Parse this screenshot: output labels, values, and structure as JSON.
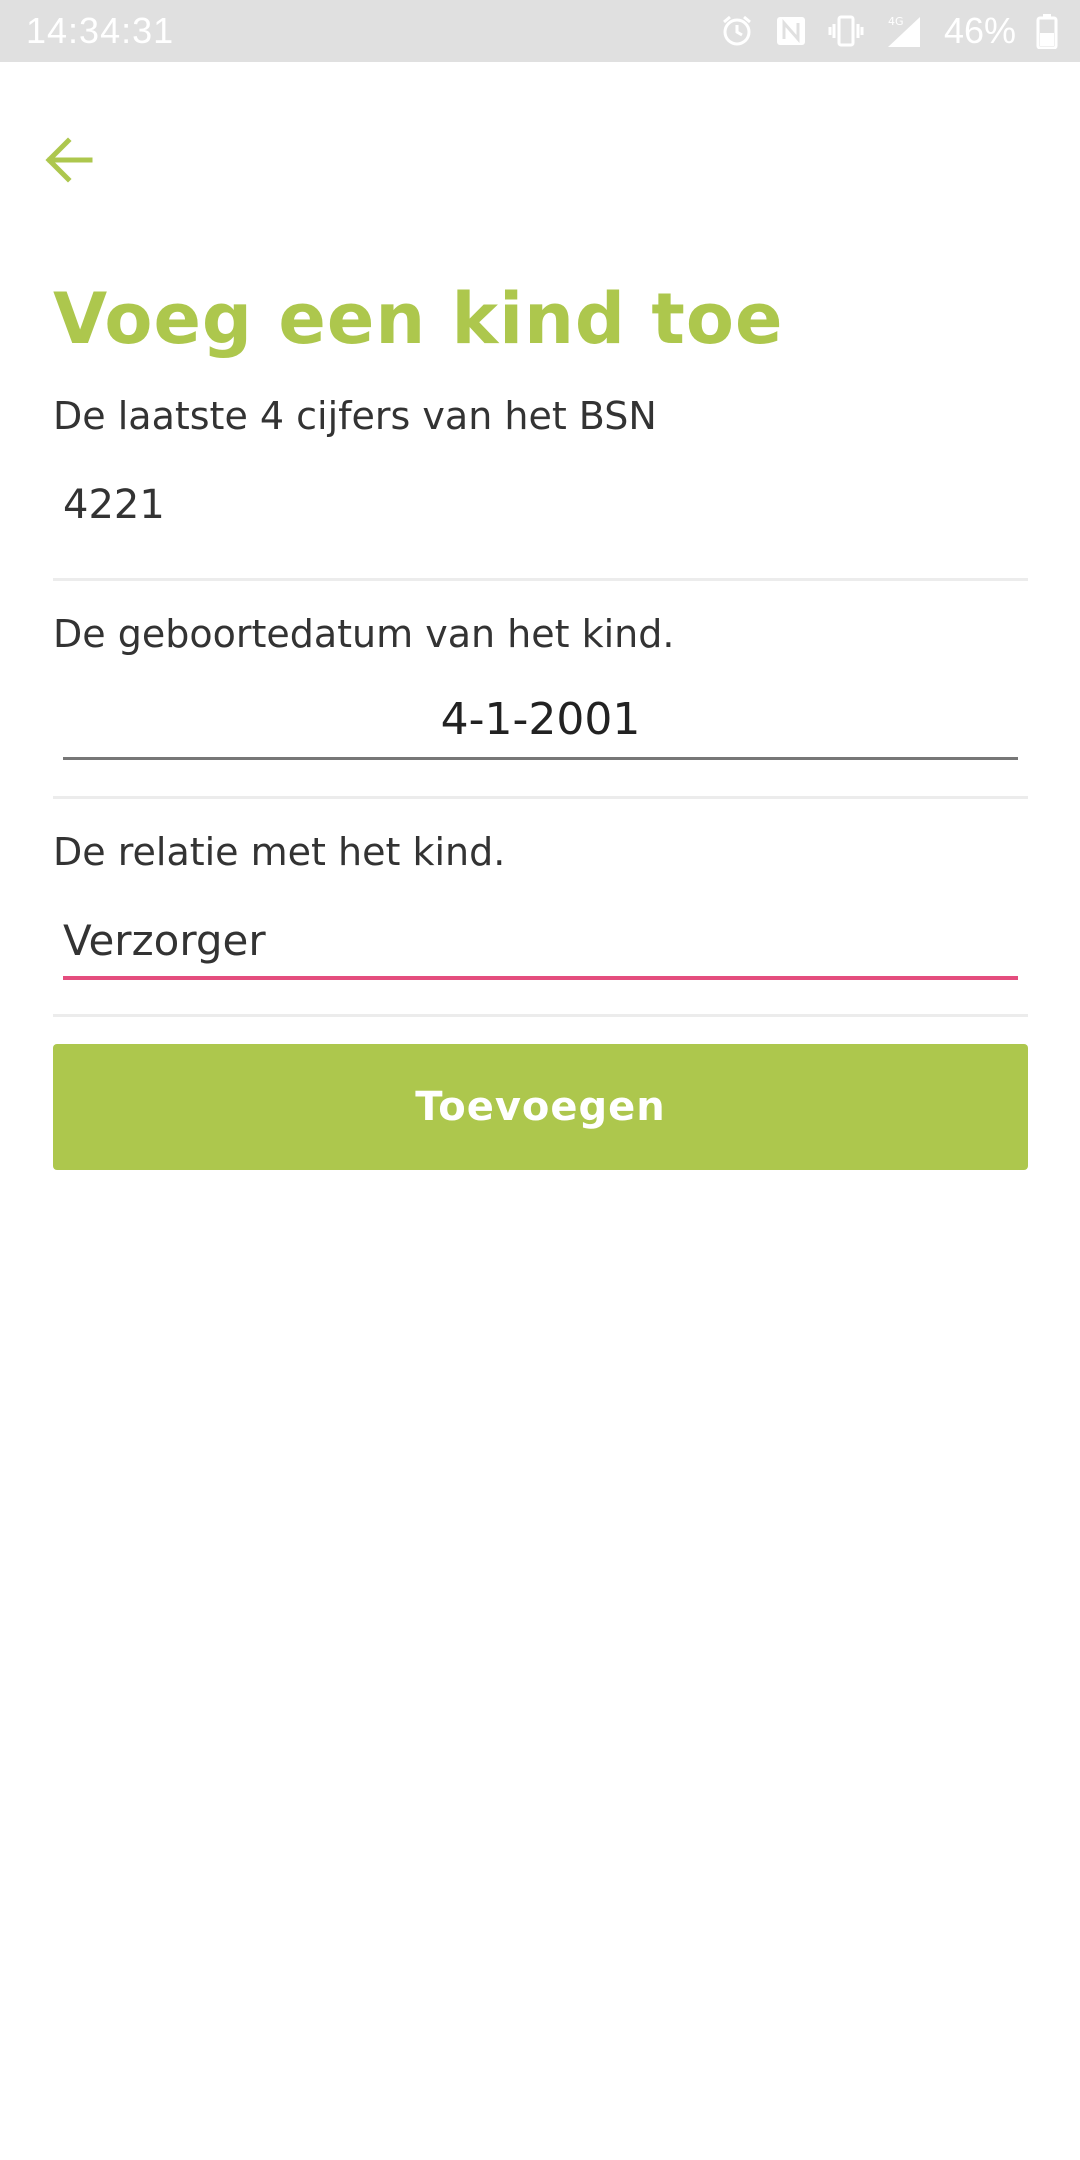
{
  "status_bar": {
    "time": "14:34:31",
    "battery": "46%",
    "icons": [
      "alarm-icon",
      "nfc-icon",
      "vibrate-icon",
      "signal-4g-icon",
      "battery-icon"
    ]
  },
  "header": {
    "back_icon": "arrow-left-icon"
  },
  "page": {
    "title": "Voeg een kind toe"
  },
  "form": {
    "bsn": {
      "label": "De laatste 4 cijfers van het BSN",
      "value": "4221"
    },
    "birthdate": {
      "label": "De geboortedatum van het kind.",
      "value": "4-1-2001"
    },
    "relation": {
      "label": "De relatie met het kind.",
      "value": "Verzorger"
    },
    "submit_label": "Toevoegen"
  },
  "colors": {
    "accent": "#adc74d",
    "focus_underline": "#e44d7e",
    "status_bar": "#e0e0e0"
  }
}
